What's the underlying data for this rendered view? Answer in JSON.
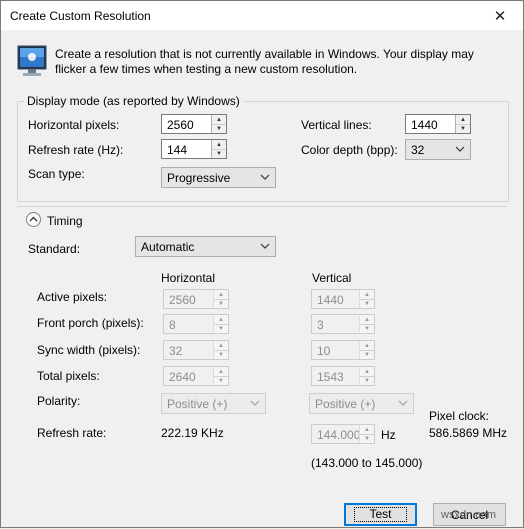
{
  "window": {
    "title": "Create Custom Resolution",
    "close_glyph": "✕"
  },
  "intro": "Create a resolution that is not currently available in Windows. Your display may flicker a few times when testing a new custom resolution.",
  "display_mode": {
    "legend": "Display mode (as reported by Windows)",
    "horizontal_pixels": {
      "label": "Horizontal pixels:",
      "value": "2560"
    },
    "vertical_lines": {
      "label": "Vertical lines:",
      "value": "1440"
    },
    "refresh_rate": {
      "label": "Refresh rate (Hz):",
      "value": "144"
    },
    "color_depth": {
      "label": "Color depth (bpp):",
      "value": "32"
    },
    "scan_type": {
      "label": "Scan type:",
      "value": "Progressive"
    }
  },
  "timing": {
    "label": "Timing",
    "standard": {
      "label": "Standard:",
      "value": "Automatic"
    },
    "col_horizontal": "Horizontal",
    "col_vertical": "Vertical",
    "rows": {
      "active": {
        "label": "Active pixels:",
        "h": "2560",
        "v": "1440"
      },
      "front_porch": {
        "label": "Front porch (pixels):",
        "h": "8",
        "v": "3"
      },
      "sync_width": {
        "label": "Sync width (pixels):",
        "h": "32",
        "v": "10"
      },
      "total": {
        "label": "Total pixels:",
        "h": "2640",
        "v": "1543"
      }
    },
    "polarity": {
      "label": "Polarity:",
      "h": "Positive (+)",
      "v": "Positive (+)"
    },
    "refresh": {
      "label": "Refresh rate:",
      "h": "222.19 KHz",
      "v": "144.000",
      "unit": "Hz",
      "range": "(143.000 to 145.000)"
    },
    "pixel_clock": {
      "label": "Pixel clock:",
      "value": "586.5869 MHz"
    }
  },
  "buttons": {
    "test": "Test",
    "cancel": "Cancel"
  },
  "watermark": "wsxdn.com",
  "colors": {
    "accent": "#0078d7",
    "disabled_text": "#8d8d8d",
    "background": "#f0f0f0"
  }
}
